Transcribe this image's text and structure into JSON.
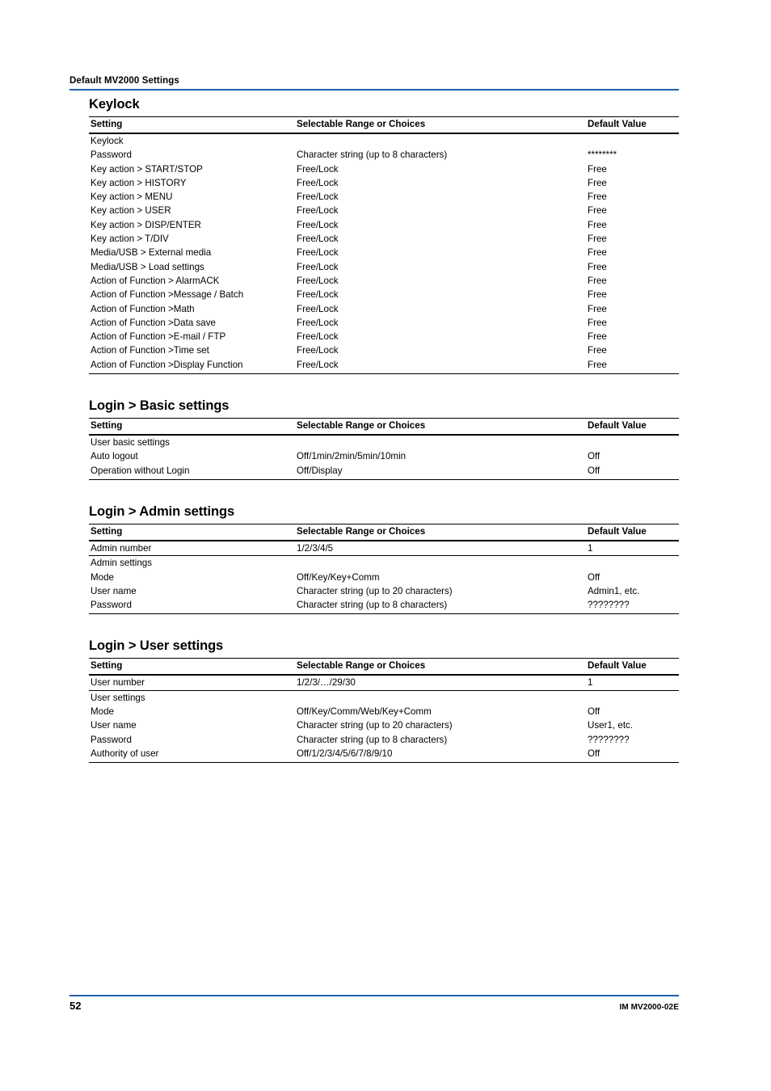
{
  "header": {
    "title": "Default MV2000 Settings",
    "rule_color": "#1F5FA9"
  },
  "columns": {
    "setting": "Setting",
    "range": "Selectable Range or Choices",
    "default": "Default Value"
  },
  "sections": [
    {
      "title": "Keylock",
      "rows": [
        {
          "level": 0,
          "setting": "Keylock",
          "range": "",
          "default": ""
        },
        {
          "level": 1,
          "setting": "Password",
          "range": "Character string (up to 8 characters)",
          "default": "********"
        },
        {
          "level": 1,
          "setting": "Key action > START/STOP",
          "range": "Free/Lock",
          "default": "Free"
        },
        {
          "level": 1,
          "setting": "Key action > HISTORY",
          "range": "Free/Lock",
          "default": "Free"
        },
        {
          "level": 1,
          "setting": "Key action > MENU",
          "range": "Free/Lock",
          "default": "Free"
        },
        {
          "level": 1,
          "setting": "Key action > USER",
          "range": "Free/Lock",
          "default": "Free"
        },
        {
          "level": 1,
          "setting": "Key action > DISP/ENTER",
          "range": "Free/Lock",
          "default": "Free"
        },
        {
          "level": 1,
          "setting": "Key action > T/DIV",
          "range": "Free/Lock",
          "default": "Free"
        },
        {
          "level": 1,
          "setting": "Media/USB > External media",
          "range": "Free/Lock",
          "default": "Free"
        },
        {
          "level": 1,
          "setting": "Media/USB > Load settings",
          "range": "Free/Lock",
          "default": "Free"
        },
        {
          "level": 1,
          "setting": "Action of Function > AlarmACK",
          "range": "Free/Lock",
          "default": "Free"
        },
        {
          "level": 1,
          "setting": "Action of Function >Message / Batch",
          "range": "Free/Lock",
          "default": "Free"
        },
        {
          "level": 1,
          "setting": "Action of Function >Math",
          "range": "Free/Lock",
          "default": "Free"
        },
        {
          "level": 1,
          "setting": "Action of Function >Data save",
          "range": "Free/Lock",
          "default": "Free"
        },
        {
          "level": 1,
          "setting": "Action of Function >E-mail / FTP",
          "range": "Free/Lock",
          "default": "Free"
        },
        {
          "level": 1,
          "setting": "Action of Function >Time set",
          "range": "Free/Lock",
          "default": "Free"
        },
        {
          "level": 1,
          "setting": "Action of Function >Display Function",
          "range": "Free/Lock",
          "default": "Free"
        }
      ]
    },
    {
      "title": "Login > Basic settings",
      "rows": [
        {
          "level": 0,
          "setting": "User basic settings",
          "range": "",
          "default": ""
        },
        {
          "level": 1,
          "setting": "Auto logout",
          "range": "Off/1min/2min/5min/10min",
          "default": "Off"
        },
        {
          "level": 1,
          "setting": "Operation without Login",
          "range": "Off/Display",
          "default": "Off"
        }
      ]
    },
    {
      "title": "Login > Admin settings",
      "rows": [
        {
          "level": 0,
          "setting": "Admin number",
          "range": "1/2/3/4/5",
          "default": "1",
          "rule_below": true
        },
        {
          "level": 0,
          "setting": "Admin settings",
          "range": "",
          "default": ""
        },
        {
          "level": 1,
          "setting": "Mode",
          "range": "Off/Key/Key+Comm",
          "default": "Off"
        },
        {
          "level": 1,
          "setting": "User name",
          "range": "Character string (up to 20 characters)",
          "default": "Admin1, etc."
        },
        {
          "level": 1,
          "setting": "Password",
          "range": "Character string (up to 8 characters)",
          "default": "????????"
        }
      ]
    },
    {
      "title": "Login > User settings",
      "rows": [
        {
          "level": 0,
          "setting": "User number",
          "range": "1/2/3/…/29/30",
          "default": "1",
          "rule_below": true
        },
        {
          "level": 0,
          "setting": "User settings",
          "range": "",
          "default": ""
        },
        {
          "level": 1,
          "setting": "Mode",
          "range": "Off/Key/Comm/Web/Key+Comm",
          "default": "Off"
        },
        {
          "level": 1,
          "setting": "User name",
          "range": "Character string (up to 20 characters)",
          "default": "User1, etc."
        },
        {
          "level": 1,
          "setting": "Password",
          "range": "Character string (up to 8 characters)",
          "default": "????????"
        },
        {
          "level": 1,
          "setting": "Authority of user",
          "range": "Off/1/2/3/4/5/6/7/8/9/10",
          "default": "Off"
        }
      ]
    }
  ],
  "footer": {
    "page_number": "52",
    "document_code": "IM MV2000-02E",
    "rule_color": "#1F5FA9"
  }
}
